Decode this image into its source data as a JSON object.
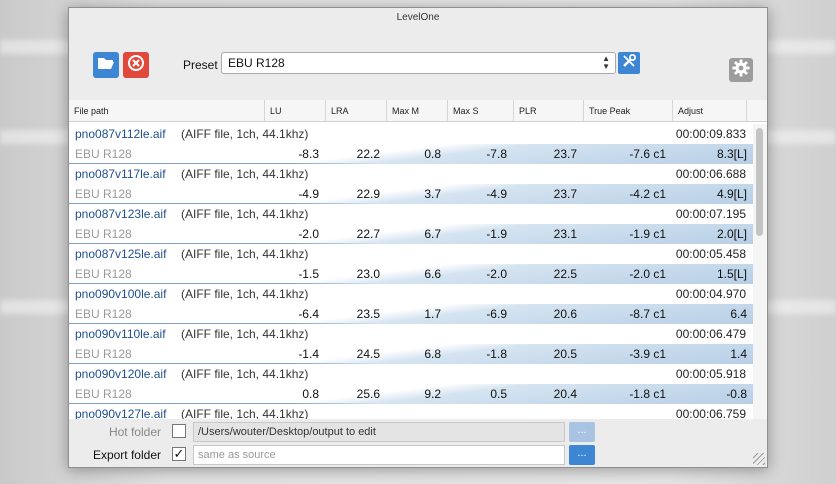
{
  "window": {
    "title": "LevelOne"
  },
  "toolbar": {
    "preset_label": "Preset",
    "preset_value": "EBU R128"
  },
  "colors": {
    "accent_blue": "#3c86d4",
    "close_red": "#e0483c",
    "filename_blue": "#1f4e8c",
    "row_separator": "#7fa3c8"
  },
  "icons": {
    "open": "folder-open-icon",
    "close": "close-icon",
    "tools": "tools-icon",
    "settings": "gear-icon"
  },
  "columns": [
    "File path",
    "LU",
    "LRA",
    "Max M",
    "Max S",
    "PLR",
    "True Peak",
    "Adjust"
  ],
  "rows": [
    {
      "file": "pno087v112le.aif",
      "info": "(AIFF file, 1ch, 44.1khz)",
      "duration": "00:00:09.833",
      "preset": "EBU R128",
      "lu": "-8.3",
      "lra": "22.2",
      "maxm": "0.8",
      "maxs": "-7.8",
      "plr": "23.7",
      "tp": "-7.6 c1",
      "adjust": "8.3[L]"
    },
    {
      "file": "pno087v117le.aif",
      "info": "(AIFF file, 1ch, 44.1khz)",
      "duration": "00:00:06.688",
      "preset": "EBU R128",
      "lu": "-4.9",
      "lra": "22.9",
      "maxm": "3.7",
      "maxs": "-4.9",
      "plr": "23.7",
      "tp": "-4.2 c1",
      "adjust": "4.9[L]"
    },
    {
      "file": "pno087v123le.aif",
      "info": "(AIFF file, 1ch, 44.1khz)",
      "duration": "00:00:07.195",
      "preset": "EBU R128",
      "lu": "-2.0",
      "lra": "22.7",
      "maxm": "6.7",
      "maxs": "-1.9",
      "plr": "23.1",
      "tp": "-1.9 c1",
      "adjust": "2.0[L]"
    },
    {
      "file": "pno087v125le.aif",
      "info": "(AIFF file, 1ch, 44.1khz)",
      "duration": "00:00:05.458",
      "preset": "EBU R128",
      "lu": "-1.5",
      "lra": "23.0",
      "maxm": "6.6",
      "maxs": "-2.0",
      "plr": "22.5",
      "tp": "-2.0 c1",
      "adjust": "1.5[L]"
    },
    {
      "file": "pno090v100le.aif",
      "info": "(AIFF file, 1ch, 44.1khz)",
      "duration": "00:00:04.970",
      "preset": "EBU R128",
      "lu": "-6.4",
      "lra": "23.5",
      "maxm": "1.7",
      "maxs": "-6.9",
      "plr": "20.6",
      "tp": "-8.7 c1",
      "adjust": "6.4"
    },
    {
      "file": "pno090v110le.aif",
      "info": "(AIFF file, 1ch, 44.1khz)",
      "duration": "00:00:06.479",
      "preset": "EBU R128",
      "lu": "-1.4",
      "lra": "24.5",
      "maxm": "6.8",
      "maxs": "-1.8",
      "plr": "20.5",
      "tp": "-3.9 c1",
      "adjust": "1.4"
    },
    {
      "file": "pno090v120le.aif",
      "info": "(AIFF file, 1ch, 44.1khz)",
      "duration": "00:00:05.918",
      "preset": "EBU R128",
      "lu": "0.8",
      "lra": "25.6",
      "maxm": "9.2",
      "maxs": "0.5",
      "plr": "20.4",
      "tp": "-1.8 c1",
      "adjust": "-0.8"
    }
  ],
  "partial_row": {
    "file": "pno090v127le.aif",
    "info": "(AIFF file, 1ch, 44.1khz)",
    "duration": "00:00:06.759"
  },
  "bottom": {
    "hot_folder_label": "Hot folder",
    "hot_folder_checked": false,
    "hot_folder_path": "/Users/wouter/Desktop/output to edit",
    "export_folder_label": "Export folder",
    "export_folder_checked": true,
    "export_folder_placeholder": "same as source",
    "browse_label": "...",
    "check_mark": "✓"
  }
}
